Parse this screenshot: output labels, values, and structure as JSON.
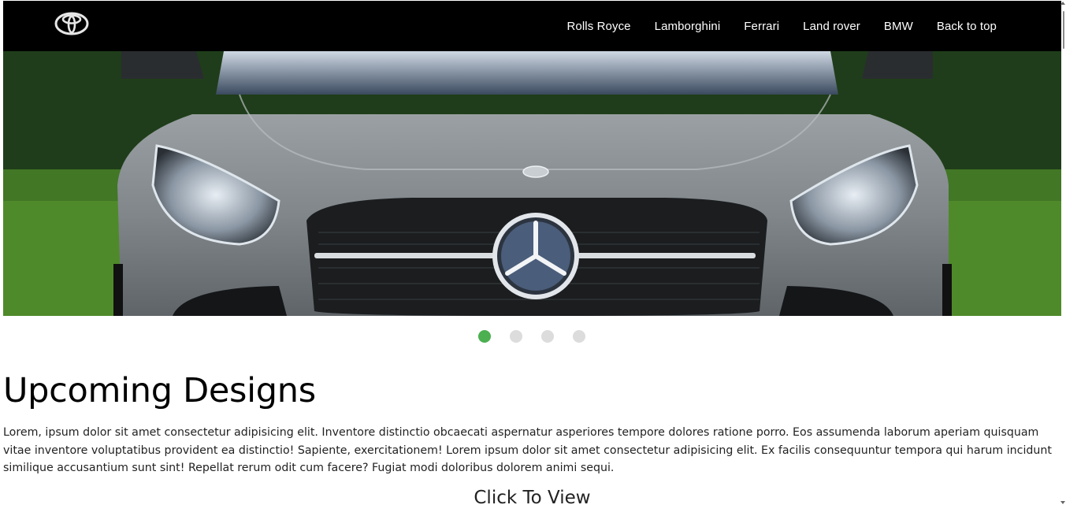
{
  "brand": {
    "logo_icon": "toyota-logo-icon"
  },
  "nav": {
    "items": [
      {
        "label": "Rolls Royce"
      },
      {
        "label": "Lamborghini"
      },
      {
        "label": "Ferrari"
      },
      {
        "label": "Land rover"
      },
      {
        "label": "BMW"
      },
      {
        "label": "Back to top"
      }
    ]
  },
  "carousel": {
    "slide_count": 4,
    "active_index": 0,
    "active_color": "#4caf50",
    "inactive_color": "#dcdcdc"
  },
  "section": {
    "title": "Upcoming Designs",
    "body": "Lorem, ipsum dolor sit amet consectetur adipisicing elit. Inventore distinctio obcaecati aspernatur asperiores tempore dolores ratione porro. Eos assumenda laborum aperiam quisquam vitae inventore voluptatibus provident ea distinctio! Sapiente, exercitationem! Lorem ipsum dolor sit amet consectetur adipisicing elit. Ex facilis consequuntur tempora qui harum incidunt similique accusantium sunt sint! Repellat rerum odit cum facere? Fugiat modi doloribus dolorem animi sequi.",
    "cta_label": "Click To View"
  },
  "colors": {
    "navbar_bg": "#000000",
    "page_bg": "#ffffff"
  }
}
